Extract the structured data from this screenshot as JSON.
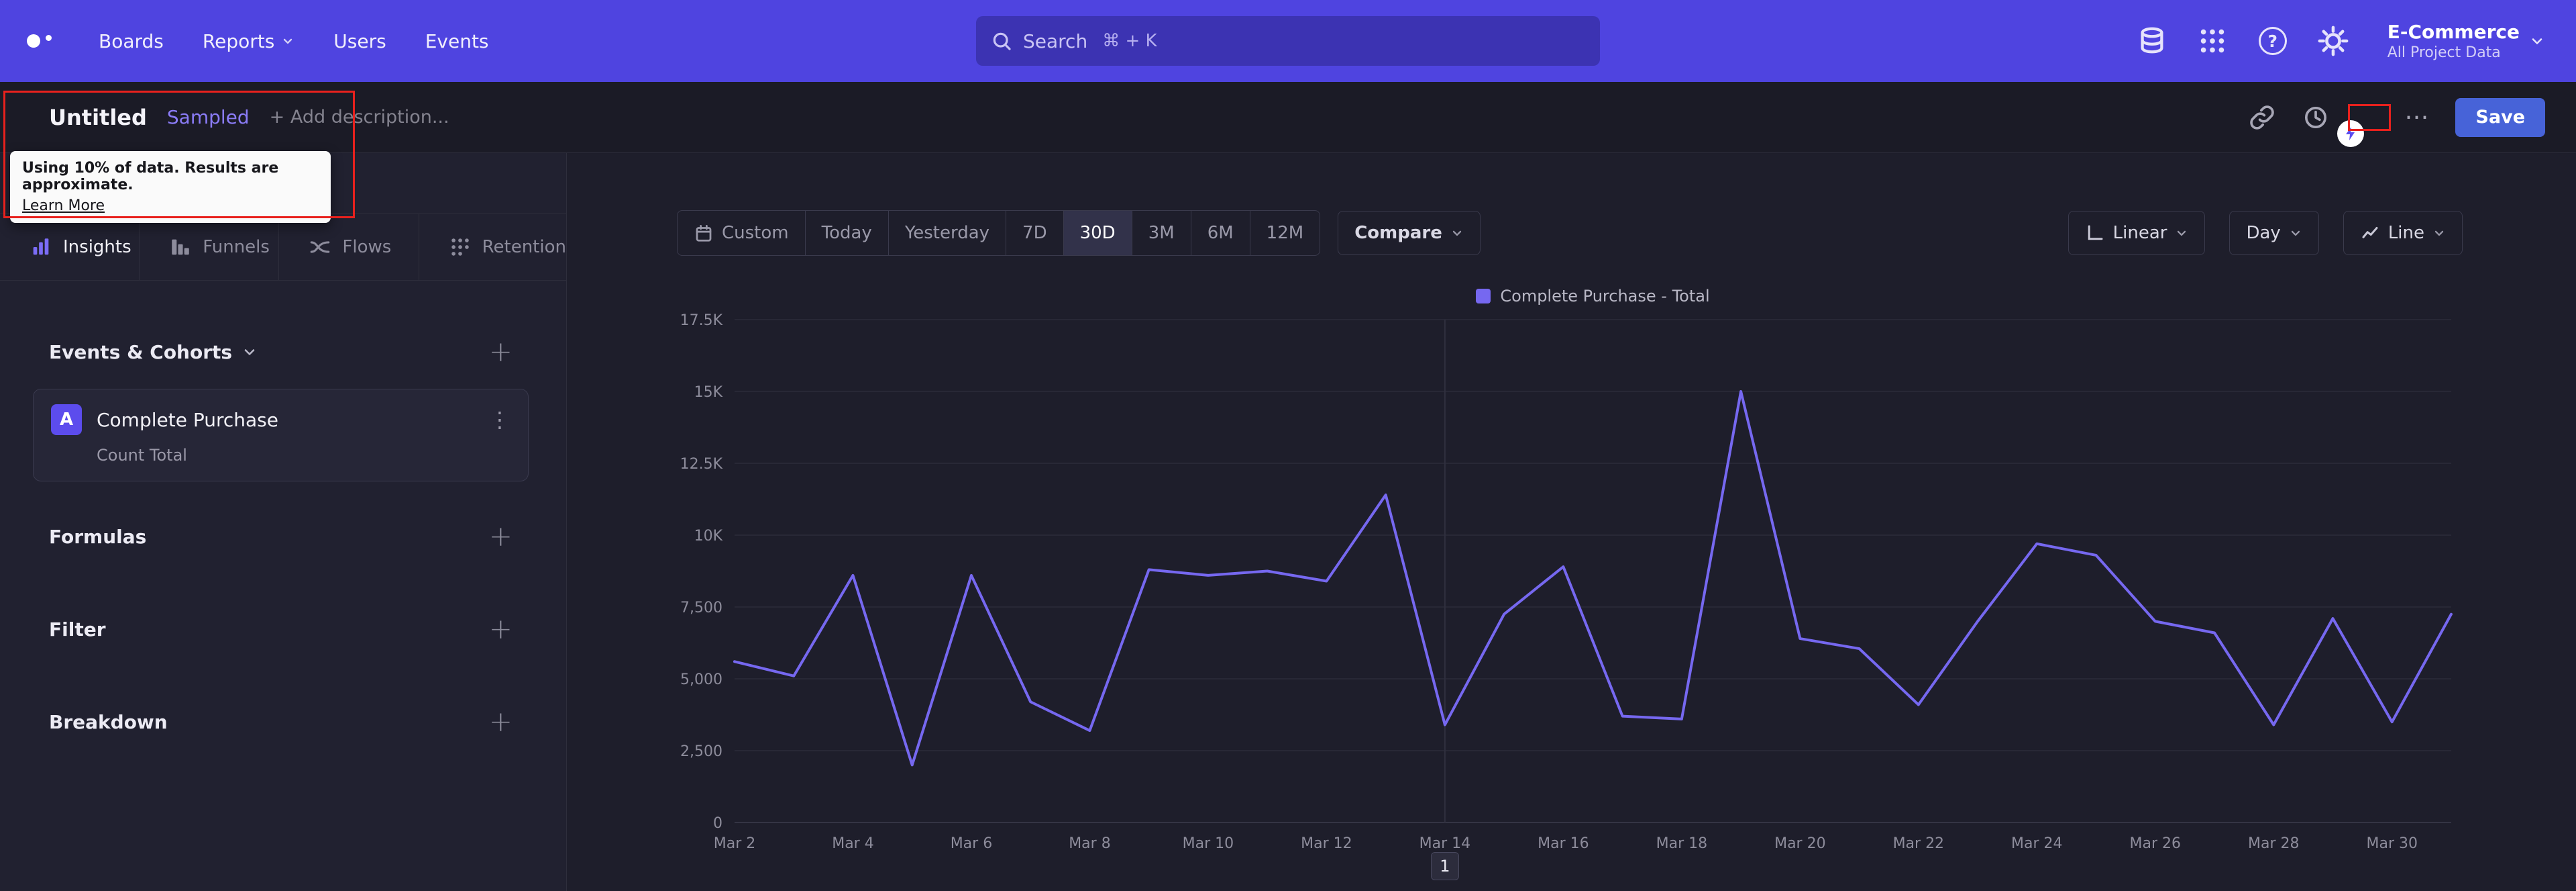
{
  "colors": {
    "navbar_bg": "#4f44e0",
    "accent_purple": "#7668f0",
    "save_blue": "#4763d8",
    "highlight_red": "#e8211d",
    "sampled_purple": "#8b7cf7"
  },
  "navbar": {
    "items": [
      {
        "label": "Boards",
        "chevron": false
      },
      {
        "label": "Reports",
        "chevron": true
      },
      {
        "label": "Users",
        "chevron": false
      },
      {
        "label": "Events",
        "chevron": false
      }
    ],
    "search": {
      "placeholder": "Search",
      "shortcut": "⌘ + K"
    },
    "icons": [
      "database-icon",
      "apps-grid-icon",
      "help-icon",
      "settings-gear-icon"
    ],
    "project": {
      "name": "E-Commerce",
      "scope": "All Project Data"
    }
  },
  "title_bar": {
    "title": "Untitled",
    "badge": "Sampled",
    "add_description": "+ Add description...",
    "tooltip": {
      "text": "Using 10% of data. Results are approximate.",
      "link": "Learn More"
    },
    "icons": [
      "share-link-icon",
      "history-icon"
    ],
    "sampling_toggle_on": true,
    "more": "⋯",
    "save_label": "Save"
  },
  "sidebar": {
    "tabs": [
      {
        "label": "Insights",
        "icon": "insights-icon",
        "active": true
      },
      {
        "label": "Funnels",
        "icon": "funnels-icon",
        "active": false
      },
      {
        "label": "Flows",
        "icon": "flows-icon",
        "active": false
      },
      {
        "label": "Retention",
        "icon": "retention-icon",
        "active": false
      }
    ],
    "events_header": "Events & Cohorts",
    "event_card": {
      "badge": "A",
      "name": "Complete Purchase",
      "metric": "Count Total"
    },
    "sections": [
      "Formulas",
      "Filter",
      "Breakdown"
    ]
  },
  "toolbar": {
    "date_ranges": [
      "Custom",
      "Today",
      "Yesterday",
      "7D",
      "30D",
      "3M",
      "6M",
      "12M"
    ],
    "active_range": "30D",
    "compare_label": "Compare",
    "view_controls": [
      {
        "label": "Linear",
        "icon": "linear-axis-icon"
      },
      {
        "label": "Day",
        "icon": ""
      },
      {
        "label": "Line",
        "icon": "line-chart-icon"
      }
    ]
  },
  "chart_data": {
    "type": "line",
    "title": "",
    "legend": [
      {
        "name": "Complete Purchase - Total",
        "color": "#7668f0"
      }
    ],
    "legend_position": "top-center",
    "x": [
      "Mar 2",
      "Mar 3",
      "Mar 4",
      "Mar 5",
      "Mar 6",
      "Mar 7",
      "Mar 8",
      "Mar 9",
      "Mar 10",
      "Mar 11",
      "Mar 12",
      "Mar 13",
      "Mar 14",
      "Mar 15",
      "Mar 16",
      "Mar 17",
      "Mar 18",
      "Mar 19",
      "Mar 20",
      "Mar 21",
      "Mar 22",
      "Mar 23",
      "Mar 24",
      "Mar 25",
      "Mar 26",
      "Mar 27",
      "Mar 28",
      "Mar 29",
      "Mar 30",
      "Mar 31"
    ],
    "values": [
      5600,
      5100,
      8600,
      2000,
      8600,
      4200,
      3200,
      8800,
      8600,
      8750,
      8400,
      11400,
      3400,
      7250,
      8900,
      3700,
      3600,
      15000,
      6400,
      6050,
      4100,
      7000,
      9700,
      9300,
      7000,
      6600,
      3400,
      7100,
      3500,
      7250
    ],
    "x_tick_labels": [
      "Mar 2",
      "Mar 4",
      "Mar 6",
      "Mar 8",
      "Mar 10",
      "Mar 12",
      "Mar 14",
      "Mar 16",
      "Mar 18",
      "Mar 20",
      "Mar 22",
      "Mar 24",
      "Mar 26",
      "Mar 28",
      "Mar 30"
    ],
    "y_ticks": [
      0,
      2500,
      5000,
      7500,
      10000,
      12500,
      15000,
      17500
    ],
    "y_tick_labels": [
      "0",
      "2,500",
      "5,000",
      "7,500",
      "10K",
      "12.5K",
      "15K",
      "17.5K"
    ],
    "ylim": [
      0,
      17500
    ],
    "line_color": "#7668f0",
    "vertical_gridline_date": "Mar 14",
    "grid": true
  },
  "pagination": {
    "page": "1"
  }
}
